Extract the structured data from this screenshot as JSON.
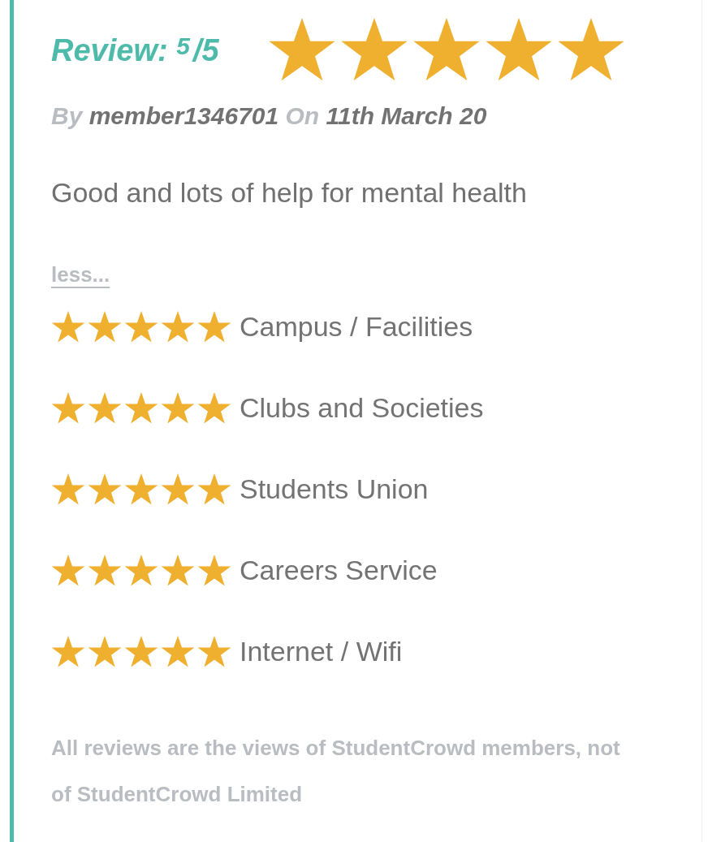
{
  "review": {
    "heading": "Review: $^{5}$/5",
    "stars": 5
  },
  "meta": "By **member1346701** On **11th March 20**",
  "title": "Good and lots of help for mental health",
  "less_link": "less...",
  "ratings": [
    {
      "label": "Campus / Facilities",
      "stars": 5
    },
    {
      "label": "Clubs and Societies",
      "stars": 5
    },
    {
      "label": "Students Union",
      "stars": 5
    },
    {
      "label": "Careers Service",
      "stars": 5
    },
    {
      "label": "Internet / Wifi",
      "stars": 5
    }
  ],
  "disclaimer": "All reviews are the views of StudentCrowd members, not of StudentCrowd Limited"
}
